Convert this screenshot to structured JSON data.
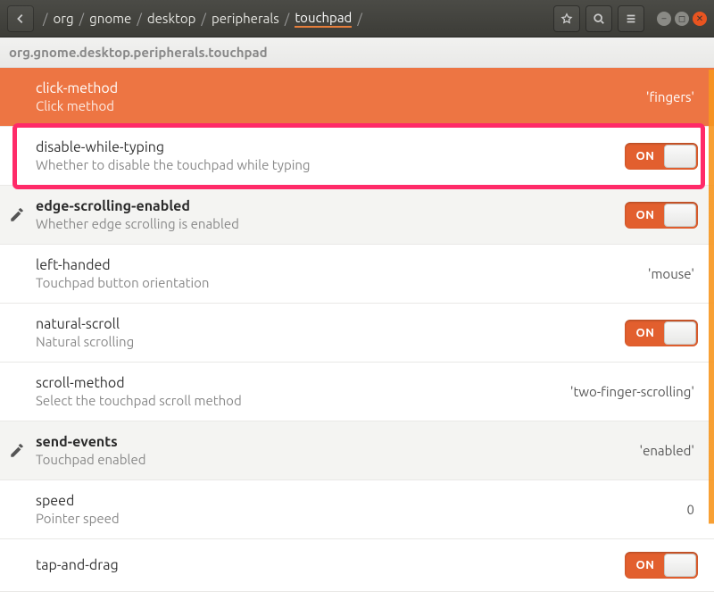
{
  "titlebar": {
    "crumbs": [
      "org",
      "gnome",
      "desktop",
      "peripherals",
      "touchpad"
    ],
    "sep": "/"
  },
  "schema_path": "org.gnome.desktop.peripherals.touchpad",
  "toggle_on_label": "ON",
  "rows": [
    {
      "key": "click-method",
      "desc": "Click method",
      "value_type": "string",
      "value": "'fingers'",
      "selected": true,
      "modified": false
    },
    {
      "key": "disable-while-typing",
      "desc": "Whether to disable the touchpad while typing",
      "value_type": "bool",
      "value": true,
      "selected": false,
      "modified": false,
      "highlighted": true
    },
    {
      "key": "edge-scrolling-enabled",
      "desc": "Whether edge scrolling is enabled",
      "value_type": "bool",
      "value": true,
      "selected": false,
      "modified": true
    },
    {
      "key": "left-handed",
      "desc": "Touchpad button orientation",
      "value_type": "string",
      "value": "'mouse'",
      "selected": false,
      "modified": false
    },
    {
      "key": "natural-scroll",
      "desc": "Natural scrolling",
      "value_type": "bool",
      "value": true,
      "selected": false,
      "modified": false
    },
    {
      "key": "scroll-method",
      "desc": "Select the touchpad scroll method",
      "value_type": "string",
      "value": "'two-finger-scrolling'",
      "selected": false,
      "modified": false
    },
    {
      "key": "send-events",
      "desc": "Touchpad enabled",
      "value_type": "string",
      "value": "'enabled'",
      "selected": false,
      "modified": true
    },
    {
      "key": "speed",
      "desc": "Pointer speed",
      "value_type": "number",
      "value": "0",
      "selected": false,
      "modified": false
    },
    {
      "key": "tap-and-drag",
      "desc": "",
      "value_type": "bool",
      "value": true,
      "selected": false,
      "modified": false
    }
  ]
}
